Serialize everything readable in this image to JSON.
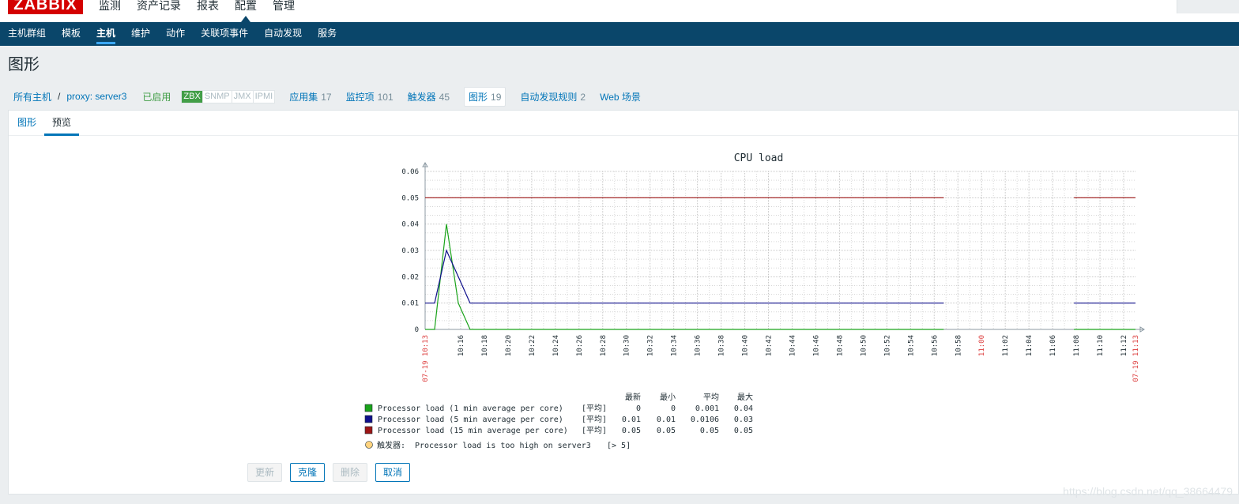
{
  "app": {
    "logo": "ZABBIX"
  },
  "main_menu": [
    "监测",
    "资产记录",
    "报表",
    "配置",
    "管理"
  ],
  "main_menu_selected": "配置",
  "sub_menu": [
    "主机群组",
    "模板",
    "主机",
    "维护",
    "动作",
    "关联项事件",
    "自动发现",
    "服务"
  ],
  "sub_menu_selected": "主机",
  "page": {
    "title": "图形"
  },
  "breadcrumb": {
    "all_hosts": "所有主机",
    "separator": "/",
    "host": "proxy: server3"
  },
  "host_status": "已启用",
  "availability": [
    {
      "label": "ZBX",
      "on": true
    },
    {
      "label": "SNMP",
      "on": false
    },
    {
      "label": "JMX",
      "on": false
    },
    {
      "label": "IPMI",
      "on": false
    }
  ],
  "host_links": [
    {
      "label": "应用集",
      "count": "17",
      "active": false
    },
    {
      "label": "监控项",
      "count": "101",
      "active": false
    },
    {
      "label": "触发器",
      "count": "45",
      "active": false
    },
    {
      "label": "图形",
      "count": "19",
      "active": true
    },
    {
      "label": "自动发现规则",
      "count": "2",
      "active": false
    },
    {
      "label": "Web 场景",
      "count": "",
      "active": false
    }
  ],
  "tabs": [
    "图形",
    "预览"
  ],
  "tab_active": "预览",
  "chart_data": {
    "type": "line",
    "title": "CPU load",
    "y_ticks": [
      "0",
      "0.01",
      "0.02",
      "0.03",
      "0.04",
      "0.05",
      "0.06"
    ],
    "ylim": [
      0,
      0.06
    ],
    "x_start": "07-19 10:13",
    "x_end": "07-19 11:13",
    "x_ticks": [
      "10:16",
      "10:18",
      "10:20",
      "10:22",
      "10:24",
      "10:26",
      "10:28",
      "10:30",
      "10:32",
      "10:34",
      "10:36",
      "10:38",
      "10:40",
      "10:42",
      "10:44",
      "10:46",
      "10:48",
      "10:50",
      "10:52",
      "10:54",
      "10:56",
      "10:58",
      "11:00",
      "11:02",
      "11:04",
      "11:06",
      "11:08",
      "11:10",
      "11:12"
    ],
    "x_ticks_highlight": [
      "11:00"
    ],
    "series": [
      {
        "name": "Processor load (1 min average per core)",
        "color": "#1aa31a",
        "func": "[平均]",
        "last": "0",
        "min": "0",
        "avg": "0.001",
        "max": "0.04",
        "points": [
          [
            "10:13",
            0
          ],
          [
            "10:13:48",
            0
          ],
          [
            "10:14:48",
            0.04
          ],
          [
            "10:15:48",
            0.01
          ],
          [
            "10:16:48",
            0
          ],
          [
            "10:56:48",
            0
          ],
          null,
          [
            "11:07:48",
            0
          ],
          [
            "11:13",
            0
          ]
        ]
      },
      {
        "name": "Processor load (5 min average per core)",
        "color": "#0f0f8c",
        "func": "[平均]",
        "last": "0.01",
        "min": "0.01",
        "avg": "0.0106",
        "max": "0.03",
        "points": [
          [
            "10:13",
            0.01
          ],
          [
            "10:13:48",
            0.01
          ],
          [
            "10:14:48",
            0.03
          ],
          [
            "10:15:48",
            0.02
          ],
          [
            "10:16:48",
            0.01
          ],
          [
            "10:56:48",
            0.01
          ],
          null,
          [
            "11:07:48",
            0.01
          ],
          [
            "11:13",
            0.01
          ]
        ]
      },
      {
        "name": "Processor load (15 min average per core)",
        "color": "#9c1515",
        "func": "[平均]",
        "last": "0.05",
        "min": "0.05",
        "avg": "0.05",
        "max": "0.05",
        "points": [
          [
            "10:13",
            0.05
          ],
          [
            "10:56:48",
            0.05
          ],
          null,
          [
            "11:07:48",
            0.05
          ],
          [
            "11:13",
            0.05
          ]
        ]
      }
    ],
    "legend_header": {
      "last": "最新",
      "min": "最小",
      "avg": "平均",
      "max": "最大"
    },
    "trigger": {
      "prefix": "触发器:",
      "name": "Processor load is too high on server3",
      "cond": "[> 5]",
      "color": "#ffd37f"
    }
  },
  "buttons": [
    {
      "label": "更新",
      "disabled": true
    },
    {
      "label": "克隆",
      "disabled": false
    },
    {
      "label": "删除",
      "disabled": true
    },
    {
      "label": "取消",
      "disabled": false
    }
  ],
  "watermark": "https://blog.csdn.net/qq_38664479"
}
